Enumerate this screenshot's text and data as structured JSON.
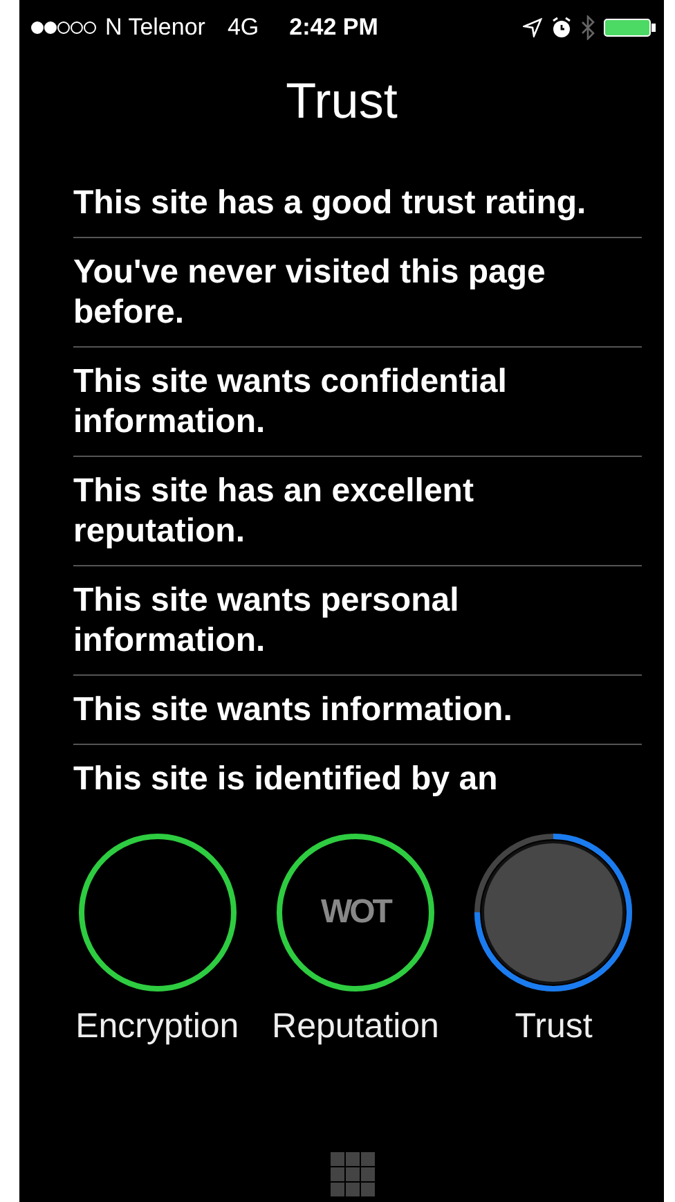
{
  "status_bar": {
    "carrier": "N Telenor",
    "network": "4G",
    "time": "2:42 PM"
  },
  "title": "Trust",
  "findings": [
    {
      "text": "This site has a good trust rating."
    },
    {
      "text": "You've never visited this page before."
    },
    {
      "text": "This site wants confidential information."
    },
    {
      "text": "This site has an excellent reputation."
    },
    {
      "text": "This site wants personal information."
    },
    {
      "text": "This site wants information."
    },
    {
      "text": "This site is identified by an"
    }
  ],
  "gauges": [
    {
      "label": "Encryption",
      "kind": "ring",
      "color": "#2ecc40"
    },
    {
      "label": "Reputation",
      "kind": "logo",
      "logo": "WOT",
      "color": "#2ecc40"
    },
    {
      "label": "Trust",
      "kind": "meter",
      "color": "#1a7cf0",
      "level": 0.75
    }
  ]
}
